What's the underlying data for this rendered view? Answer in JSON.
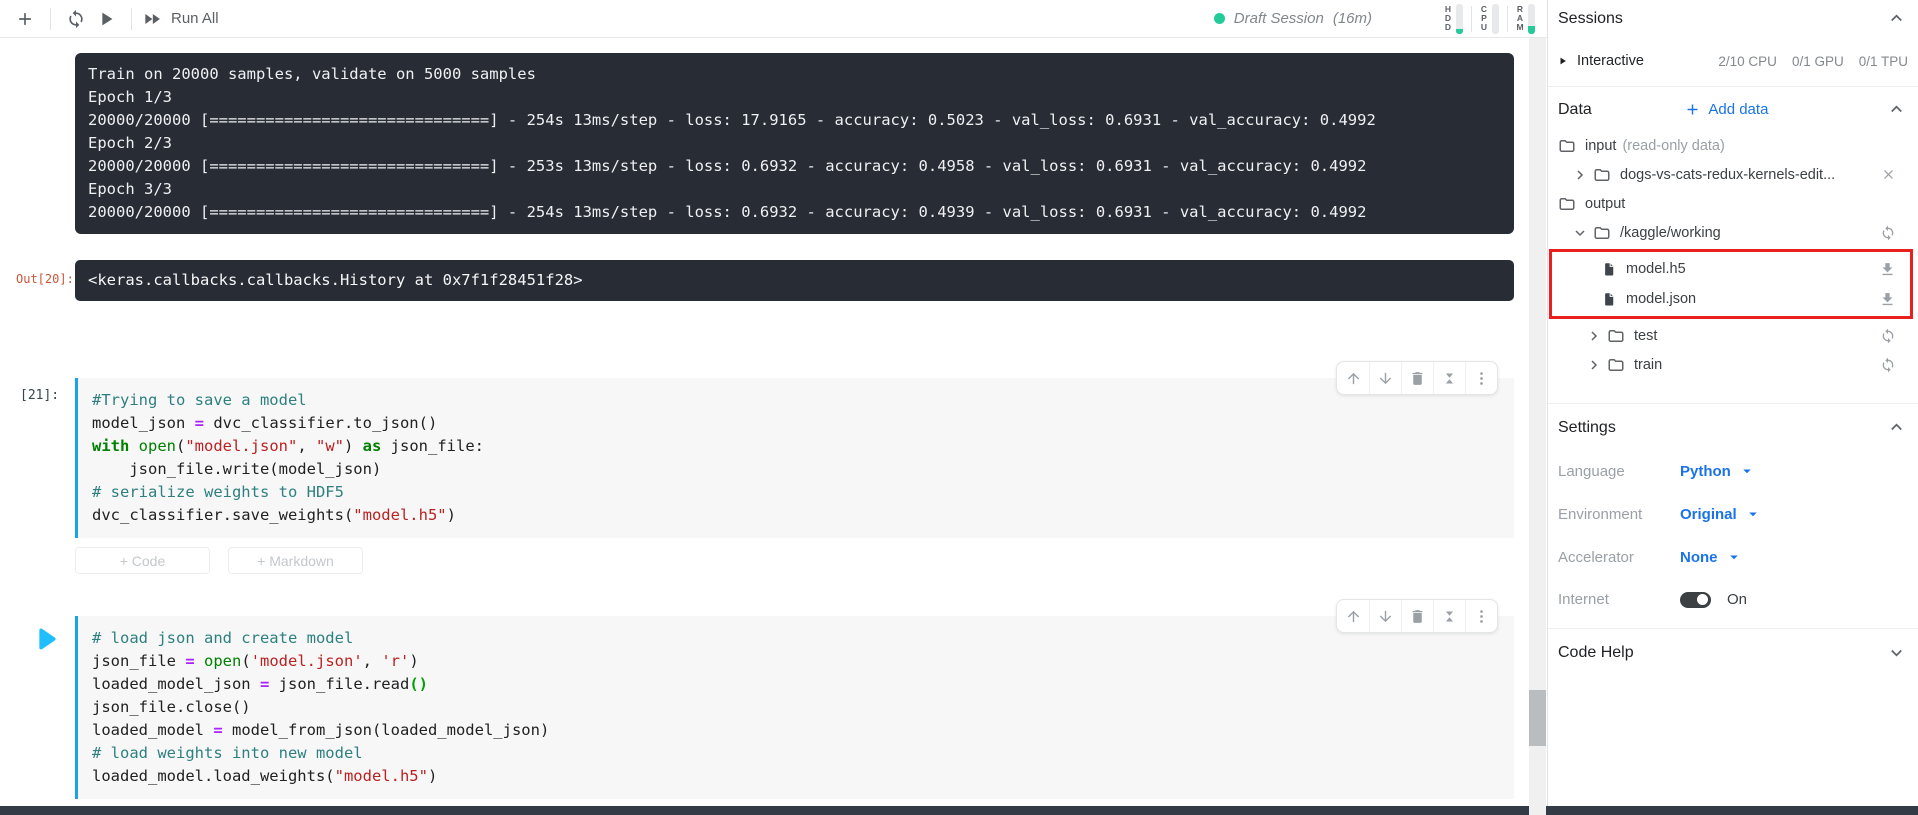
{
  "toolbar": {
    "run_all_label": "Run All",
    "session": {
      "label": "Draft Session",
      "time": "(16m)",
      "dot_color": "#24ca9a"
    },
    "monitors": [
      {
        "label": "HDD",
        "fill_pct": 15
      },
      {
        "label": "CPU",
        "fill_pct": 0
      },
      {
        "label": "RAM",
        "fill_pct": 25
      }
    ]
  },
  "console": {
    "lines": [
      "Train on 20000 samples, validate on 5000 samples",
      "Epoch 1/3",
      "20000/20000 [==============================] - 254s 13ms/step - loss: 17.9165 - accuracy: 0.5023 - val_loss: 0.6931 - val_accuracy: 0.4992",
      "Epoch 2/3",
      "20000/20000 [==============================] - 253s 13ms/step - loss: 0.6932 - accuracy: 0.4958 - val_loss: 0.6931 - val_accuracy: 0.4992",
      "Epoch 3/3",
      "20000/20000 [==============================] - 254s 13ms/step - loss: 0.6932 - accuracy: 0.4939 - val_loss: 0.6931 - val_accuracy: 0.4992"
    ]
  },
  "out_cell": {
    "label": "Out[20]:",
    "value": "<keras.callbacks.callbacks.History at 0x7f1f28451f28>"
  },
  "cells": [
    {
      "label": "[21]:",
      "lines": [
        [
          [
            "cm",
            "#Trying to save a model"
          ]
        ],
        [
          [
            "tx",
            "model_json "
          ],
          [
            "op",
            "="
          ],
          [
            "tx",
            " dvc_classifier.to_json()"
          ]
        ],
        [
          [
            "kw",
            "with"
          ],
          [
            "tx",
            " "
          ],
          [
            "bi",
            "open"
          ],
          [
            "tx",
            "("
          ],
          [
            "st",
            "\"model.json\""
          ],
          [
            "tx",
            ", "
          ],
          [
            "st",
            "\"w\""
          ],
          [
            "tx",
            ") "
          ],
          [
            "kw",
            "as"
          ],
          [
            "tx",
            " json_file:"
          ]
        ],
        [
          [
            "tx",
            "    json_file.write(model_json)"
          ]
        ],
        [
          [
            "cm",
            "# serialize weights to HDF5"
          ]
        ],
        [
          [
            "tx",
            "dvc_classifier.save_weights("
          ],
          [
            "st",
            "\"model.h5\""
          ],
          [
            "tx",
            ")"
          ]
        ]
      ]
    },
    {
      "label": "",
      "lines": [
        [
          [
            "cm",
            "# load json and create model"
          ]
        ],
        [
          [
            "tx",
            "json_file "
          ],
          [
            "op",
            "="
          ],
          [
            "tx",
            " "
          ],
          [
            "bi",
            "open"
          ],
          [
            "tx",
            "("
          ],
          [
            "st",
            "'model.json'"
          ],
          [
            "tx",
            ", "
          ],
          [
            "st",
            "'r'"
          ],
          [
            "tx",
            ")"
          ]
        ],
        [
          [
            "tx",
            "loaded_model_json "
          ],
          [
            "op",
            "="
          ],
          [
            "tx",
            " json_file.read"
          ],
          [
            "mb",
            "()"
          ]
        ],
        [
          [
            "tx",
            "json_file.close()"
          ]
        ],
        [
          [
            "tx",
            "loaded_model "
          ],
          [
            "op",
            "="
          ],
          [
            "tx",
            " model_from_json(loaded_model_json)"
          ]
        ],
        [
          [
            "cm",
            "# load weights into new model"
          ]
        ],
        [
          [
            "tx",
            "loaded_model.load_weights("
          ],
          [
            "st",
            "\"model.h5\""
          ],
          [
            "tx",
            ")"
          ]
        ]
      ]
    }
  ],
  "add_buttons": {
    "code": "+ Code",
    "markdown": "+ Markdown"
  },
  "sidebar": {
    "sessions": {
      "title": "Sessions",
      "row_label": "Interactive",
      "stats": [
        "2/10 CPU",
        "0/1 GPU",
        "0/1 TPU"
      ]
    },
    "data": {
      "title": "Data",
      "add_label": "Add data",
      "highlight_color": "#e8201e",
      "tree": {
        "input": {
          "label": "input",
          "suffix": "(read-only data)"
        },
        "dataset": {
          "label": "dogs-vs-cats-redux-kernels-edit..."
        },
        "output": {
          "label": "output"
        },
        "working": {
          "label": "/kaggle/working"
        },
        "model_h5": {
          "label": "model.h5"
        },
        "model_json": {
          "label": "model.json"
        },
        "test": {
          "label": "test"
        },
        "train": {
          "label": "train"
        }
      }
    },
    "settings": {
      "title": "Settings",
      "rows": [
        {
          "label": "Language",
          "value": "Python"
        },
        {
          "label": "Environment",
          "value": "Original"
        },
        {
          "label": "Accelerator",
          "value": "None"
        }
      ],
      "internet": {
        "label": "Internet",
        "value": "On"
      }
    },
    "code_help": {
      "title": "Code Help"
    }
  }
}
